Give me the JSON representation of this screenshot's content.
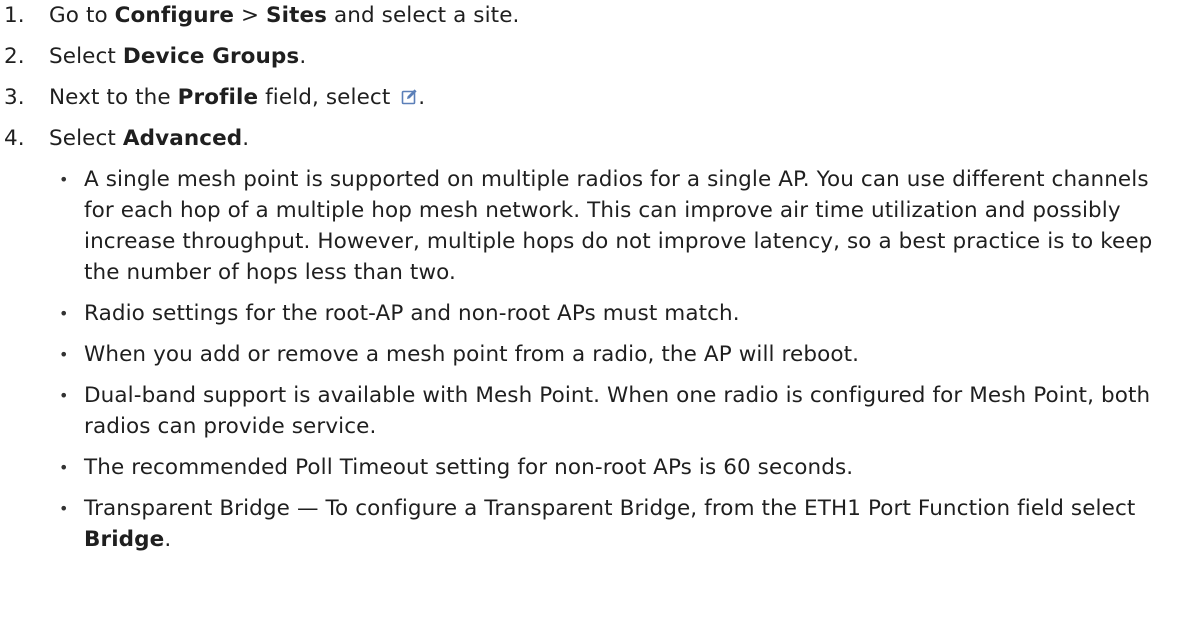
{
  "steps": [
    {
      "num": "1.",
      "t1": "Go to ",
      "b1": "Configure",
      "t2": " > ",
      "b2": "Sites",
      "t3": " and select a site."
    },
    {
      "num": "2.",
      "t1": "Select ",
      "b1": "Device Groups",
      "t2": "."
    },
    {
      "num": "3.",
      "t1": "Next to the ",
      "b1": "Profile",
      "t2": " field, select ",
      "icon": "edit-icon",
      "t3": "."
    },
    {
      "num": "4.",
      "t1": "Select ",
      "b1": "Advanced",
      "t2": "."
    }
  ],
  "notes": [
    {
      "text": "A single mesh point is supported on multiple radios for a single AP. You can use different channels for each hop of a multiple hop mesh network. This can improve air time utilization and possibly increase throughput. However, multiple hops do not improve latency, so a best practice is to keep the number of hops less than two."
    },
    {
      "text": "Radio settings for the root-AP and non-root APs must match."
    },
    {
      "text": "When you add or remove a mesh point from a radio, the AP will reboot."
    },
    {
      "text": "Dual-band support is available with Mesh Point. When one radio is configured for Mesh Point, both radios can provide service."
    },
    {
      "text": "The recommended Poll Timeout setting for non-root APs is 60 seconds."
    },
    {
      "text": "Transparent Bridge — To configure a Transparent Bridge, from the ETH1 Port Function field select ",
      "bold": "Bridge",
      "tail": "."
    }
  ],
  "bullet_char": "•",
  "colors": {
    "text": "#1f1f1f",
    "icon": "#5b7fb8"
  }
}
